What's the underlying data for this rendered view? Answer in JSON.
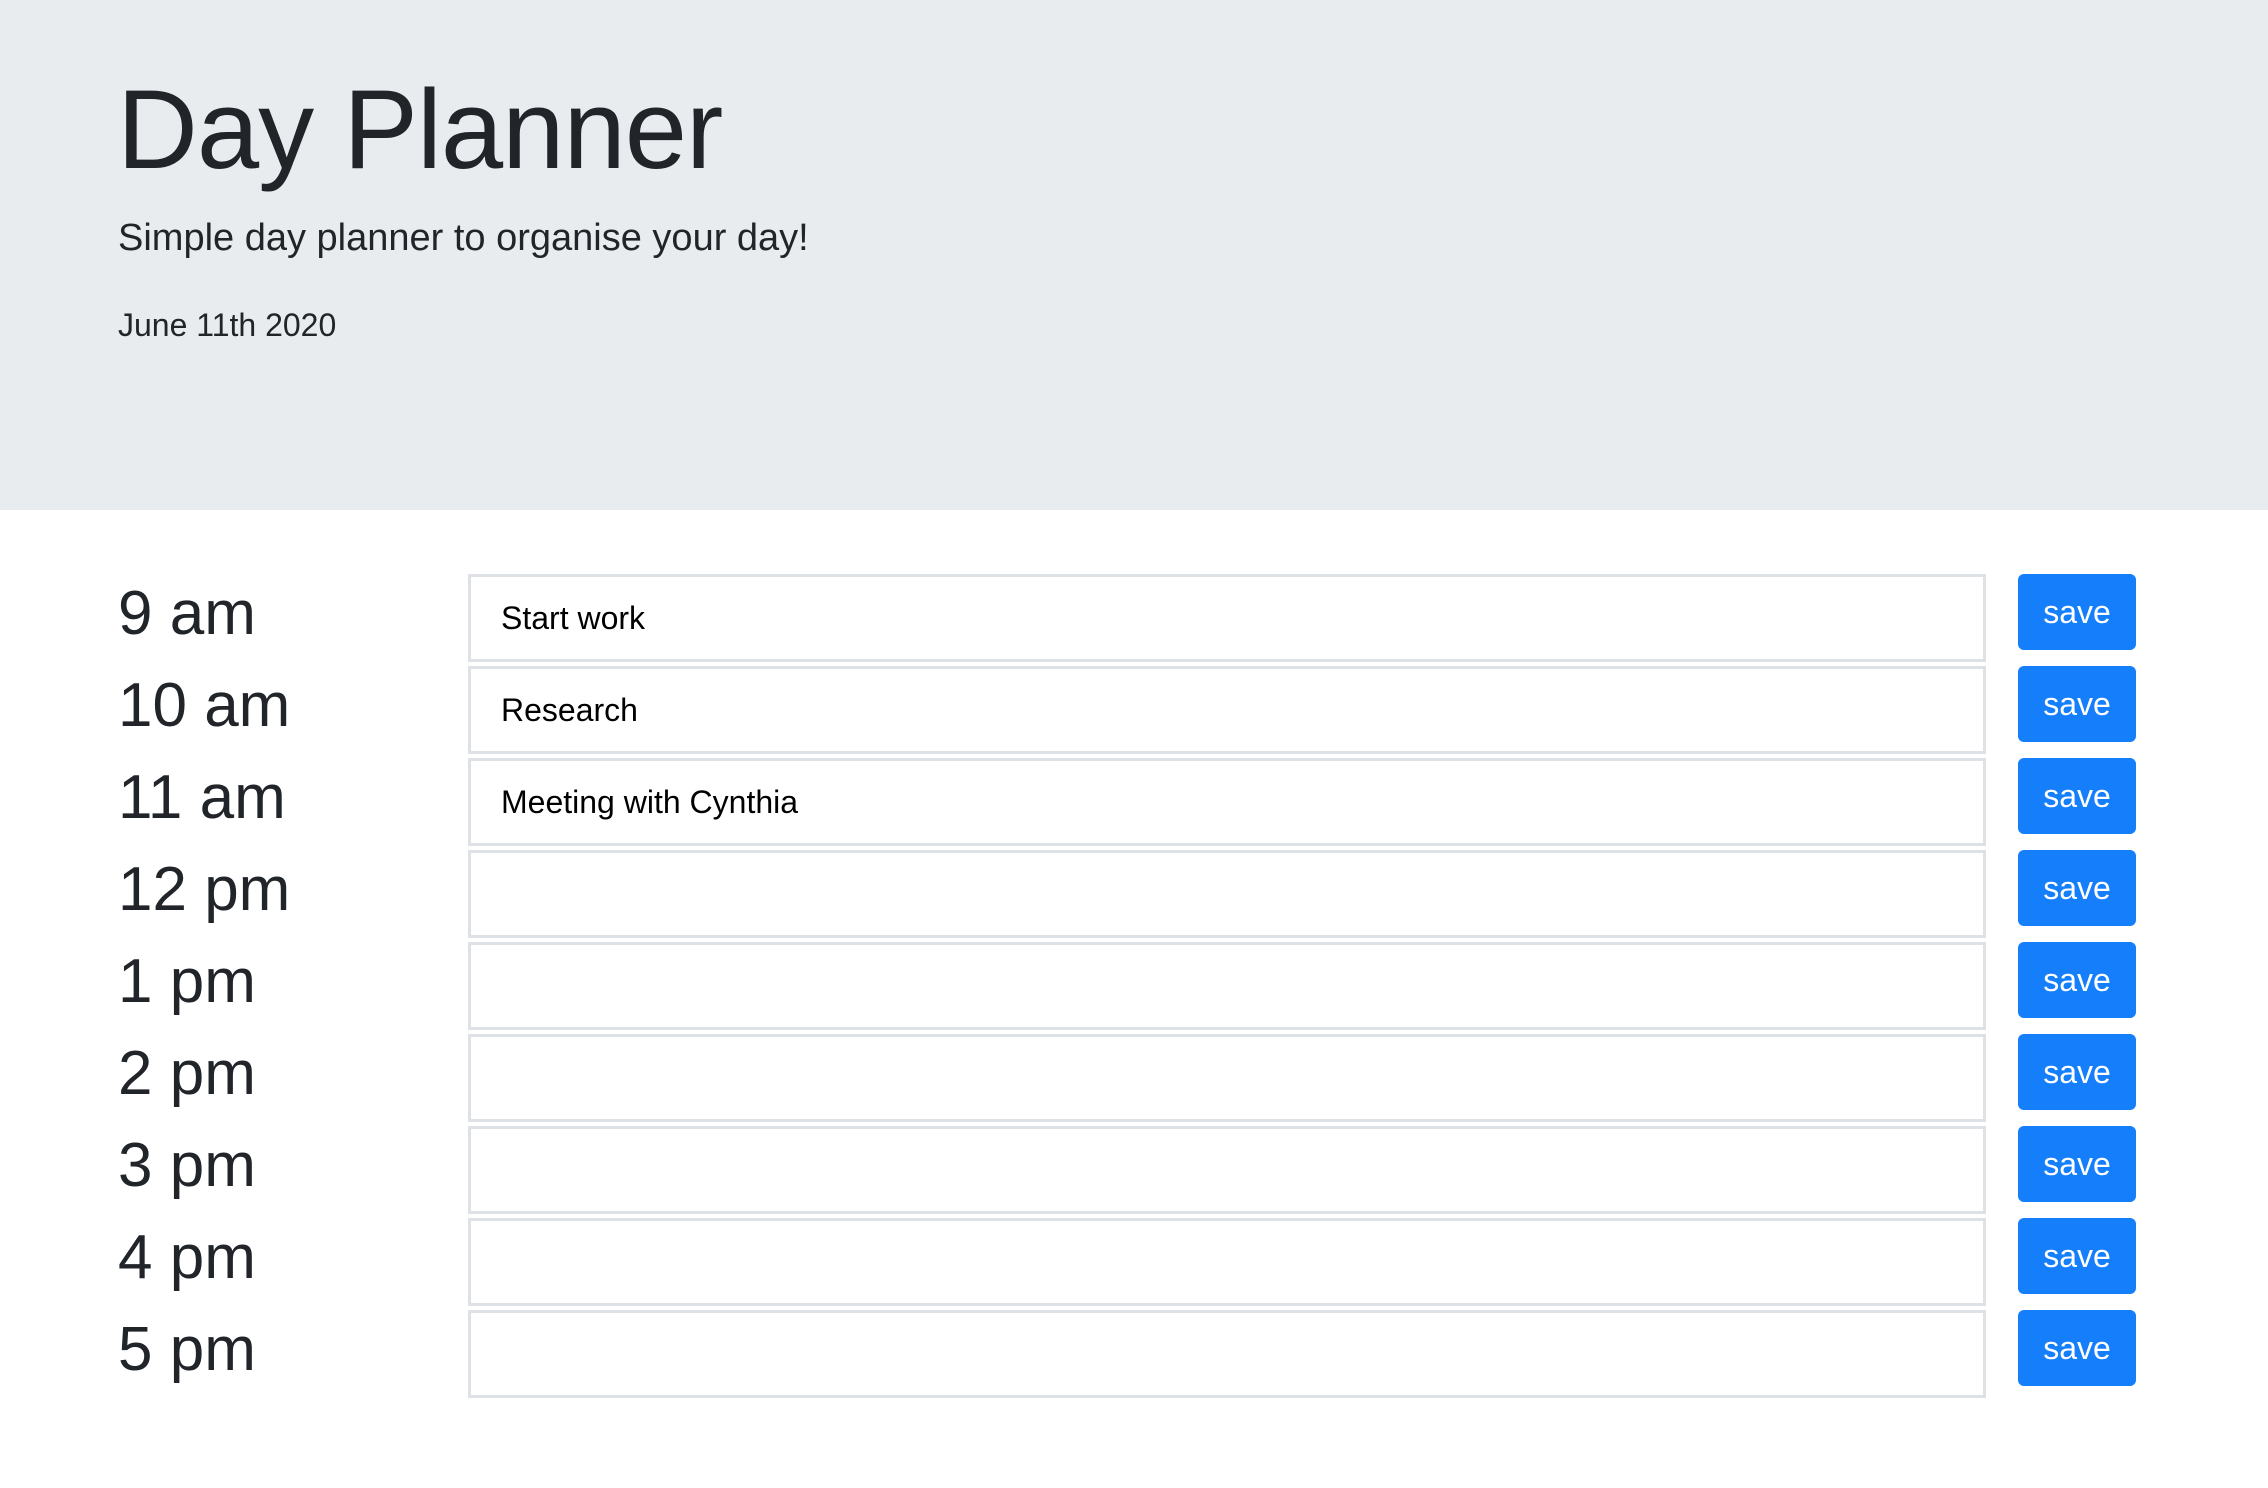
{
  "header": {
    "title": "Day Planner",
    "subtitle": "Simple day planner to organise your day!",
    "date": "June 11th 2020"
  },
  "timeblocks": [
    {
      "hour": "9 am",
      "task": "Start work",
      "save_label": "save"
    },
    {
      "hour": "10 am",
      "task": "Research",
      "save_label": "save"
    },
    {
      "hour": "11 am",
      "task": "Meeting with Cynthia",
      "save_label": "save"
    },
    {
      "hour": "12 pm",
      "task": "",
      "save_label": "save"
    },
    {
      "hour": "1 pm",
      "task": "",
      "save_label": "save"
    },
    {
      "hour": "2 pm",
      "task": "",
      "save_label": "save"
    },
    {
      "hour": "3 pm",
      "task": "",
      "save_label": "save"
    },
    {
      "hour": "4 pm",
      "task": "",
      "save_label": "save"
    },
    {
      "hour": "5 pm",
      "task": "",
      "save_label": "save"
    }
  ],
  "colors": {
    "header_bg": "#e9ecef",
    "save_button": "#147efb",
    "text": "#212529",
    "input_border": "#dee2e6"
  }
}
